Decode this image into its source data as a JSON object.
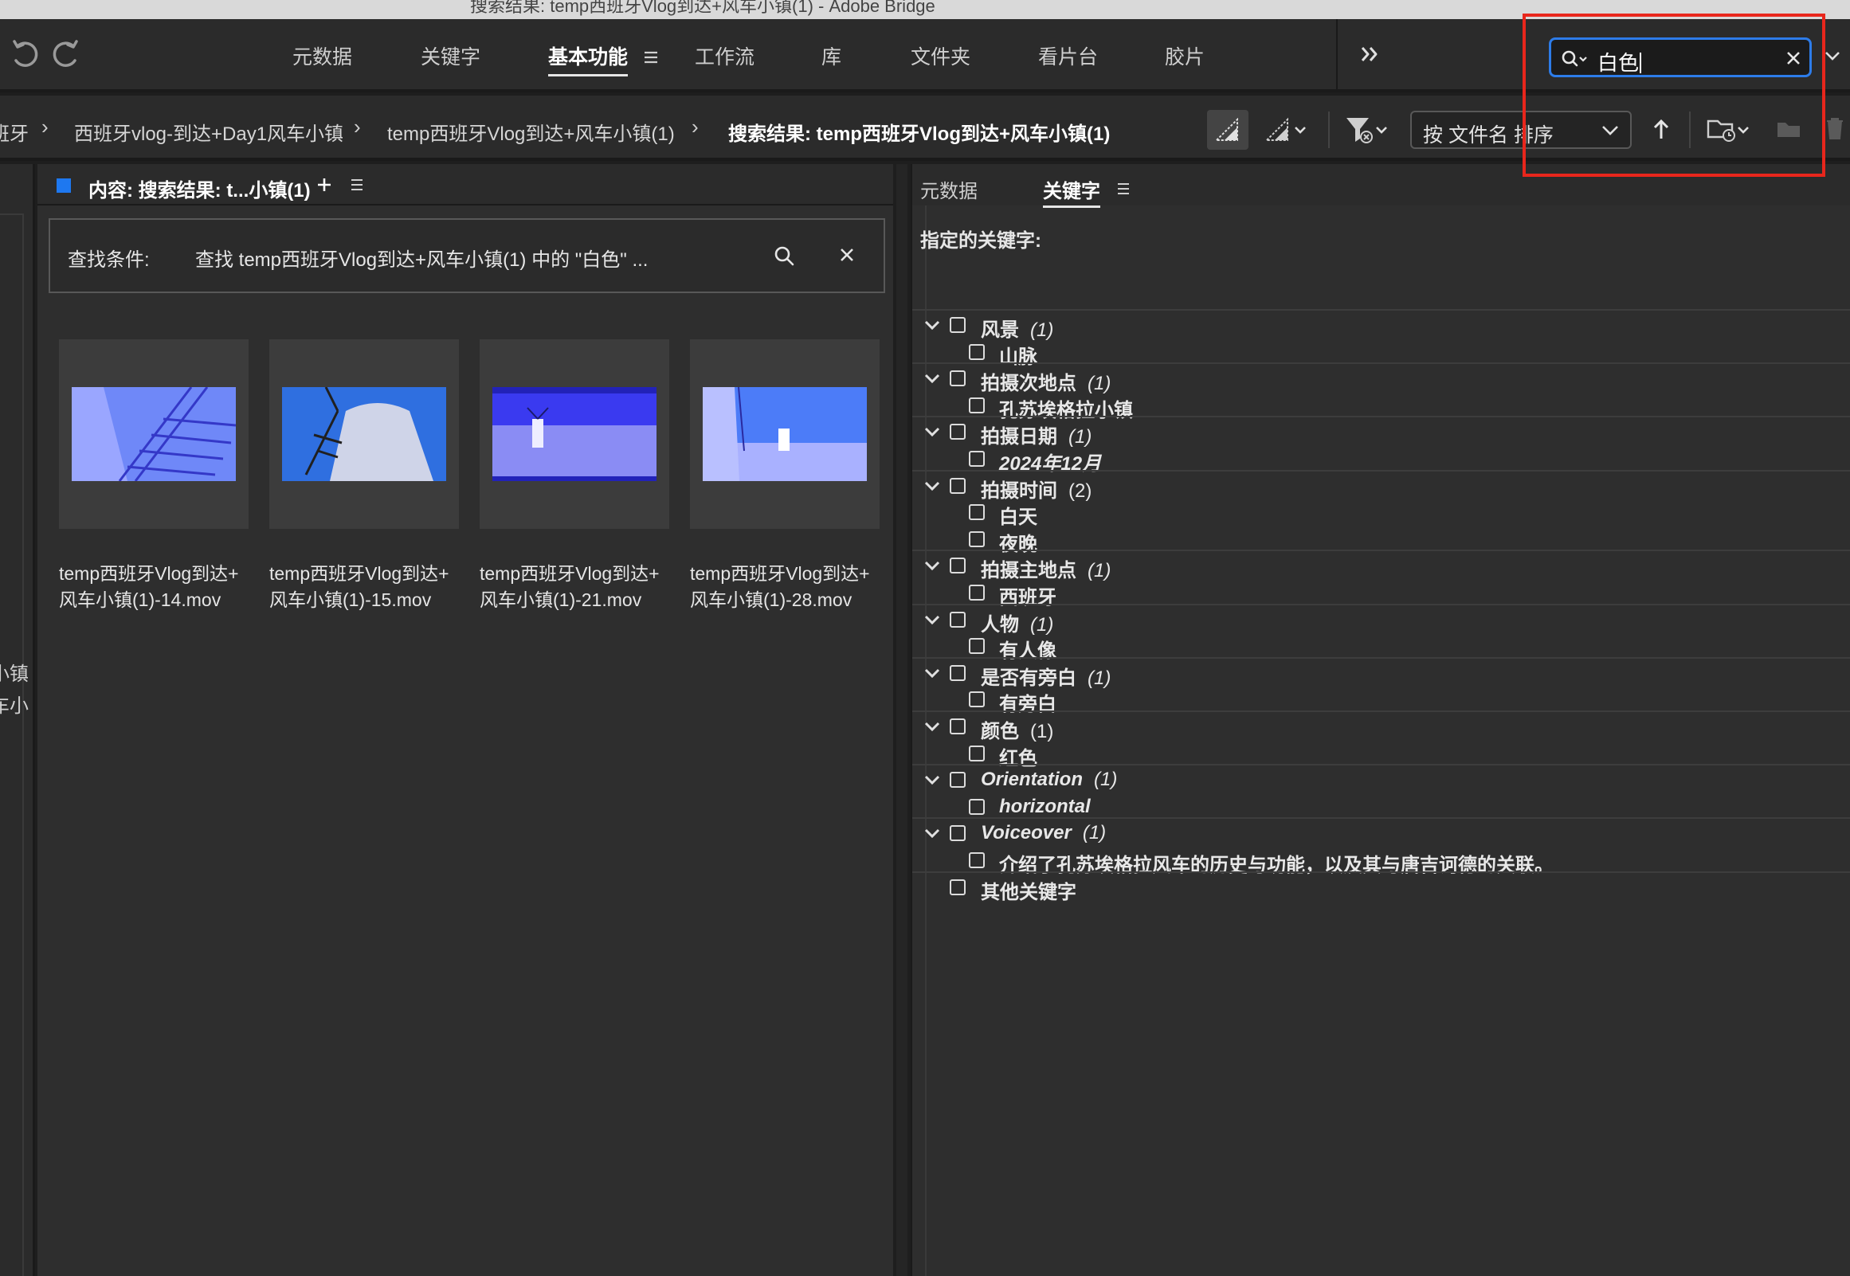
{
  "window": {
    "title": "搜索结果: temp西班牙Vlog到达+风车小镇(1) - Adobe Bridge"
  },
  "toolbar": {
    "tabs": [
      {
        "label": "元数据",
        "active": false
      },
      {
        "label": "关键字",
        "active": false
      },
      {
        "label": "基本功能",
        "active": true
      },
      {
        "label": "工作流",
        "active": false
      },
      {
        "label": "库",
        "active": false
      },
      {
        "label": "文件夹",
        "active": false
      },
      {
        "label": "看片台",
        "active": false
      },
      {
        "label": "胶片",
        "active": false
      }
    ],
    "search_value": "白色",
    "accent_color": "#2d7ce9",
    "highlight_color": "#e8261c"
  },
  "breadcrumb": {
    "items": [
      {
        "label": "班牙"
      },
      {
        "label": "西班牙vlog-到达+Day1风车小镇"
      },
      {
        "label": "temp西班牙Vlog到达+风车小镇(1)"
      },
      {
        "label": "搜索结果: temp西班牙Vlog到达+风车小镇(1)"
      }
    ],
    "sort_label": "按 文件名 排序"
  },
  "left_sliver": {
    "lines": [
      "小镇",
      "车小"
    ]
  },
  "content": {
    "header_title": "内容: 搜索结果: t...小镇(1)",
    "criteria_label": "查找条件:",
    "criteria_value": "查找 temp西班牙Vlog到达+风车小镇(1) 中的 \"白色\" ...",
    "thumbnails": [
      {
        "name_line1": "temp西班牙Vlog到达+",
        "name_line2": "风车小镇(1)-14.mov"
      },
      {
        "name_line1": "temp西班牙Vlog到达+",
        "name_line2": "风车小镇(1)-15.mov"
      },
      {
        "name_line1": "temp西班牙Vlog到达+",
        "name_line2": "风车小镇(1)-21.mov"
      },
      {
        "name_line1": "temp西班牙Vlog到达+",
        "name_line2": "风车小镇(1)-28.mov"
      }
    ]
  },
  "right_panel": {
    "tabs": [
      {
        "label": "元数据",
        "active": false
      },
      {
        "label": "关键字",
        "active": true
      }
    ],
    "assigned_label": "指定的关键字:",
    "keyword_groups": [
      {
        "label": "风景",
        "count": "(1)",
        "count_italic": true,
        "children": [
          "山脉"
        ]
      },
      {
        "label": "拍摄次地点",
        "count": "(1)",
        "count_italic": true,
        "children": [
          "孔苏埃格拉小镇"
        ]
      },
      {
        "label": "拍摄日期",
        "count": "(1)",
        "count_italic": true,
        "children": [
          "2024年12月"
        ]
      },
      {
        "label": "拍摄时间",
        "count": "(2)",
        "count_italic": false,
        "children": [
          "白天",
          "夜晚"
        ]
      },
      {
        "label": "拍摄主地点",
        "count": "(1)",
        "count_italic": true,
        "children": [
          "西班牙"
        ]
      },
      {
        "label": "人物",
        "count": "(1)",
        "count_italic": true,
        "children": [
          "有人像"
        ]
      },
      {
        "label": "是否有旁白",
        "count": "(1)",
        "count_italic": true,
        "children": [
          "有旁白"
        ]
      },
      {
        "label": "颜色",
        "count": "(1)",
        "count_italic": false,
        "children": [
          "红色"
        ]
      },
      {
        "label": "Orientation",
        "count": "(1)",
        "count_italic": true,
        "children": [
          "horizontal"
        ]
      },
      {
        "label": "Voiceover",
        "count": "(1)",
        "count_italic": true,
        "children": [
          "介绍了孔苏埃格拉风车的历史与功能，以及其与唐吉诃德的关联。"
        ]
      }
    ],
    "other_keywords": "其他关键字"
  }
}
